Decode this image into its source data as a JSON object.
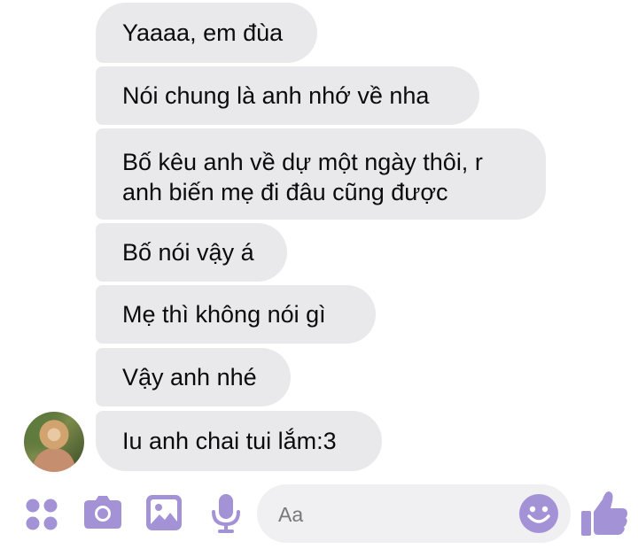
{
  "conversation": {
    "messages": [
      {
        "text": "Yaaaa, em đùa"
      },
      {
        "text": "Nói chung là anh nhớ về nha"
      },
      {
        "text": "Bố kêu anh về dự một ngày thôi, r anh biến mẹ đi đâu cũng được"
      },
      {
        "text": "Bố nói vậy á"
      },
      {
        "text": "Mẹ thì không nói gì"
      },
      {
        "text": "Vậy anh nhé"
      },
      {
        "text": "Iu anh chai tui lắm:3"
      }
    ]
  },
  "composer": {
    "placeholder": "Aa"
  },
  "theme": {
    "accent": "#a392d6",
    "bubble_bg": "#e9e9eb"
  },
  "icons": [
    "apps-icon",
    "camera-icon",
    "gallery-icon",
    "microphone-icon",
    "emoji-icon",
    "thumbs-up-icon"
  ]
}
